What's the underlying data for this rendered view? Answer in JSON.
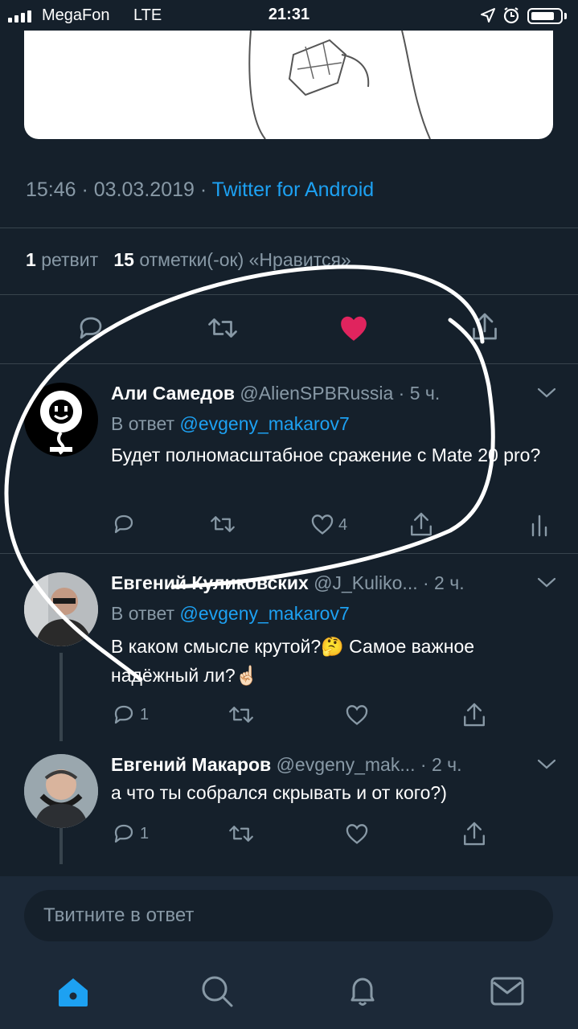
{
  "status_bar": {
    "carrier": "MegaFon",
    "network": "LTE",
    "time": "21:31"
  },
  "main_tweet": {
    "time_date": "15:46 · 03.03.2019 · ",
    "source": "Twitter for Android",
    "retweets_count": "1",
    "retweets_label": "ретвит",
    "likes_count": "15",
    "likes_label": "отметки(-ок) «Нравится»",
    "liked": true
  },
  "replies": [
    {
      "name": "Али Самедов",
      "handle": "@AlienSPBRussia",
      "time": " · 5 ч.",
      "reply_label": "В ответ",
      "reply_to": "@evgeny_makarov7",
      "text": "Будет полномасштабное сражение с Mate 20 pro?",
      "reply_count": "",
      "like_count": "4"
    },
    {
      "name": "Евгений Куликовских",
      "handle": "@J_Kuliko...",
      "time": " · 2 ч.",
      "reply_label": "В ответ",
      "reply_to": "@evgeny_makarov7",
      "text": "В каком смысле крутой?🤔 Самое важное надёжный ли?☝🏻",
      "reply_count": "1",
      "like_count": ""
    },
    {
      "name": "Евгений Макаров",
      "handle": "@evgeny_mak...",
      "time": " · 2 ч.",
      "text": "а что ты собрался скрывать и от кого?)",
      "reply_count": "1",
      "like_count": ""
    }
  ],
  "composer": {
    "placeholder": "Твитните в ответ"
  },
  "tab_bar": {
    "items": [
      "home-icon",
      "search-icon",
      "notifications-icon",
      "messages-icon"
    ],
    "active": "home-icon"
  },
  "colors": {
    "background": "#15202b",
    "accent": "#1da1f2",
    "like": "#e0245e",
    "muted": "#8899a6"
  }
}
